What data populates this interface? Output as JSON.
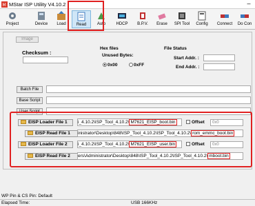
{
  "window": {
    "title": "MStar ISP Utility V4.10.2"
  },
  "toolbar": {
    "buttons": [
      {
        "label": "Project",
        "icon": "gear-icon"
      },
      {
        "label": "Device",
        "icon": "device-icon"
      },
      {
        "label": "Load",
        "icon": "load-icon"
      },
      {
        "label": "Read",
        "icon": "read-icon"
      },
      {
        "label": "Auto",
        "icon": "auto-icon"
      },
      {
        "label": "HDCP",
        "icon": "hdcp-icon"
      },
      {
        "label": "B.P.V.",
        "icon": "bpv-icon"
      },
      {
        "label": "Erase",
        "icon": "erase-icon"
      },
      {
        "label": "SPI Tool",
        "icon": "spi-tool-icon"
      },
      {
        "label": "Config",
        "icon": "config-icon"
      },
      {
        "label": "Connect",
        "icon": "connect-icon"
      },
      {
        "label": "Do Con",
        "icon": "do-connect-icon"
      }
    ],
    "active": "Read",
    "highlight_color": "#e02020"
  },
  "image_button": "Image",
  "checksum": {
    "label": "Checksum :",
    "value": ""
  },
  "hex_files": {
    "title": "Hex files",
    "unused_label": "Unused Bytes:",
    "options": [
      "0x00",
      "0xFF"
    ],
    "selected": "0x00"
  },
  "file_status": {
    "title": "File Status",
    "start_label": "Start Addr. :",
    "end_label": "End Addr. :",
    "start_value": "",
    "end_value": ""
  },
  "scripts": {
    "batch_label": "Batch File",
    "base_label": "Base Script",
    "user_label": "User Script"
  },
  "eisp_rows": [
    {
      "label": "EISP Loader File 1",
      "path_prefix": "i_4.10.2\\ISP_Tool_4.10.2\\",
      "path_highlight": "M7621_EISP_boot.bin",
      "offset_label": "Offset",
      "offset_value": "0x0"
    },
    {
      "label": "EISP Read File 1",
      "path_prefix": "inistrator\\Desktop\\848\\ISP_Tool_4.10.2\\ISP_Tool_4.10.2\\",
      "path_highlight": "rom_emmc_boot.bin",
      "offset_label": "",
      "offset_value": ""
    },
    {
      "label": "EISP Loader File 2",
      "path_prefix": "i_4.10.2\\ISP_Tool_4.10.2\\",
      "path_highlight": "M7621_EISP_user.bin",
      "offset_label": "Offset",
      "offset_value": "0x0"
    },
    {
      "label": "EISP Read File 2",
      "path_prefix": "ers\\Administrator\\Desktop\\848\\ISP_Tool_4.10.2\\ISP_Tool_4.10.2\\",
      "path_highlight": "mboot.bin",
      "offset_label": "",
      "offset_value": ""
    }
  ],
  "status": {
    "pins": "WP Pin & CS Pin: Default",
    "elapsed": "Elapsed Time:",
    "speed": "USB  166KHz"
  }
}
